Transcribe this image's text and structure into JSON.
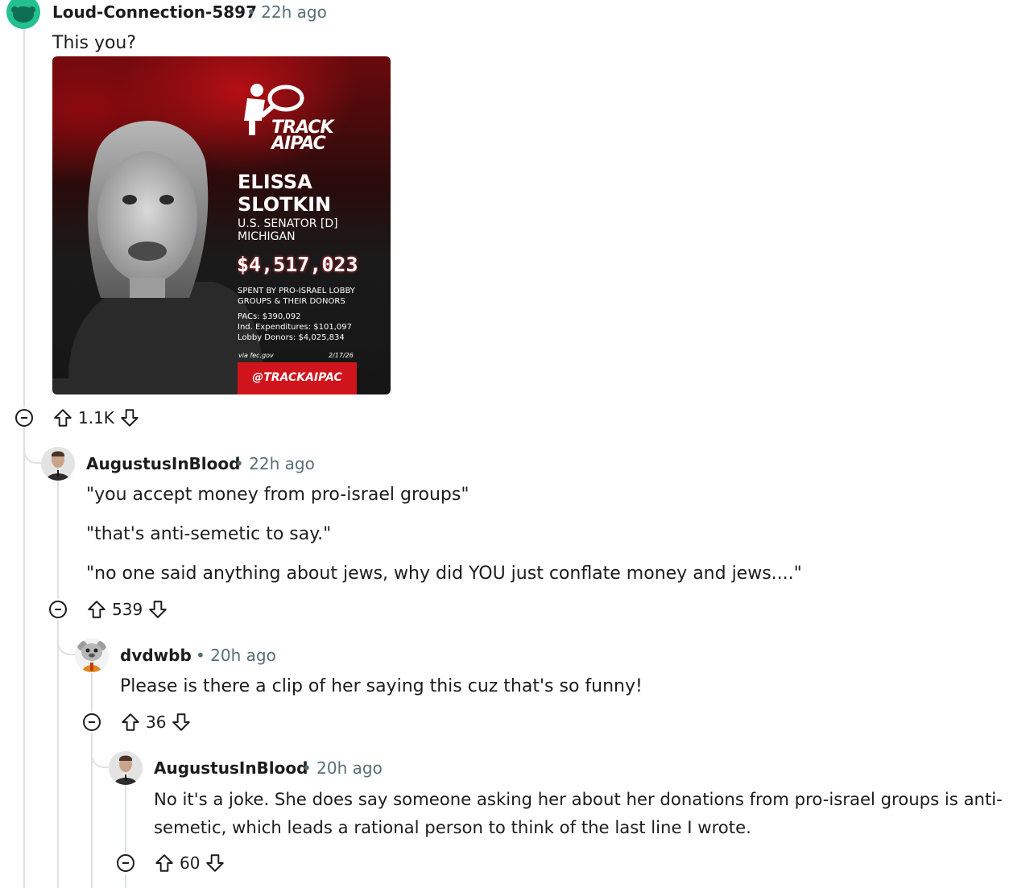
{
  "comments": [
    {
      "author": "Loud-Connection-5897",
      "time": "• 22h ago",
      "body": [
        "This you?"
      ],
      "score": "1.1K",
      "image": {
        "brand": [
          "TRACK",
          "AIPAC"
        ],
        "name": [
          "ELISSA",
          "SLOTKIN"
        ],
        "role": [
          "U.S. SENATOR [D]",
          "MICHIGAN"
        ],
        "amount": "$4,517,023",
        "spent": [
          "SPENT BY PRO-ISRAEL LOBBY",
          "GROUPS & THEIR DONORS"
        ],
        "breakdown": [
          "PACs: $390,092",
          "Ind. Expenditures: $101,097",
          "Lobby Donors: $4,025,834"
        ],
        "source": "via fec.gov",
        "date": "2/17/26",
        "handle": "@TRACKAIPAC",
        "accent": "#d0141b"
      }
    },
    {
      "author": "AugustusInBlood",
      "time": "• 22h ago",
      "body": [
        "\"you accept money from pro-israel groups\"",
        "\"that's anti-semetic to say.\"",
        "\"no one said anything about jews, why did YOU just conflate money and jews....\""
      ],
      "score": "539"
    },
    {
      "author": "dvdwbb",
      "time": "• 20h ago",
      "body": [
        "Please is there a clip of her saying this cuz that's so funny!"
      ],
      "score": "36"
    },
    {
      "author": "AugustusInBlood",
      "time": "• 20h ago",
      "body": [
        "No it's a joke. She does say someone asking her about her donations from pro-israel groups is anti-",
        "semetic, which leads a rational person to think of the last line I wrote."
      ],
      "score": "60"
    }
  ]
}
